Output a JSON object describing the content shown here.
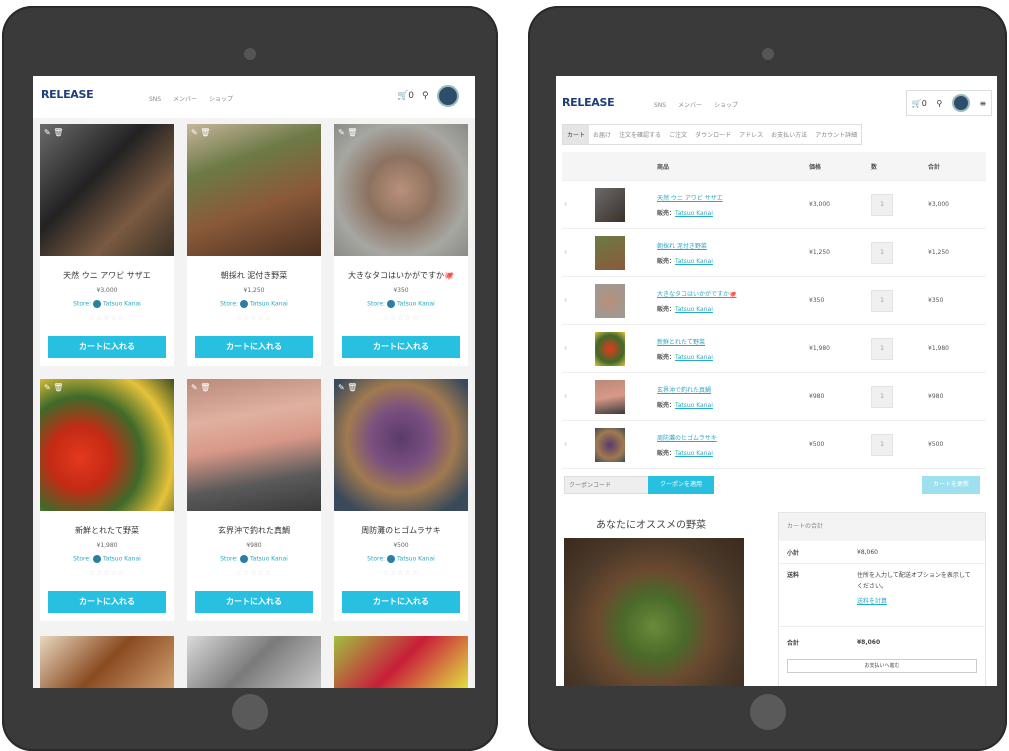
{
  "left": {
    "logo": "RELEASE",
    "nav": [
      "SNS",
      "メンバー",
      "ショップ"
    ],
    "cart_count": "0",
    "products": [
      {
        "name": "天然 ウニ アワビ サザエ",
        "price": "¥3,000",
        "store": "Store:",
        "seller": "Tatsuo Kanai",
        "button": "カートに入れる"
      },
      {
        "name": "朝採れ 泥付き野菜",
        "price": "¥1,250",
        "store": "Store:",
        "seller": "Tatsuo Kanai",
        "button": "カートに入れる"
      },
      {
        "name": "大きなタコはいかがですか🐙",
        "price": "¥350",
        "store": "Store:",
        "seller": "Tatsuo Kanai",
        "button": "カートに入れる"
      },
      {
        "name": "新鮮とれたて野菜",
        "price": "¥1,980",
        "store": "Store:",
        "seller": "Tatsuo Kanai",
        "button": "カートに入れる"
      },
      {
        "name": "玄界沖で釣れた真鯛",
        "price": "¥980",
        "store": "Store:",
        "seller": "Tatsuo Kanai",
        "button": "カートに入れる"
      },
      {
        "name": "周防灘のヒゴムラサキ",
        "price": "¥500",
        "store": "Store:",
        "seller": "Tatsuo Kanai",
        "button": "カートに入れる"
      }
    ]
  },
  "right": {
    "logo": "RELEASE",
    "nav": [
      "SNS",
      "メンバー",
      "ショップ"
    ],
    "cart_count": "0",
    "tabs": [
      "カート",
      "お届け",
      "注文を確認する",
      "ご注文",
      "ダウンロード",
      "アドレス",
      "お支払い方法",
      "アカウント詳細"
    ],
    "columns": [
      "商品",
      "価格",
      "数",
      "合計"
    ],
    "seller_label": "販売：",
    "rows": [
      {
        "name": "天然 ウニ アワビ サザエ",
        "seller": "Tatsuo Kanai",
        "price": "¥3,000",
        "qty": "1",
        "total": "¥3,000"
      },
      {
        "name": "朝採れ 泥付き野菜",
        "seller": "Tatsuo Kanai",
        "price": "¥1,250",
        "qty": "1",
        "total": "¥1,250"
      },
      {
        "name": "大きなタコはいかがですか🐙",
        "seller": "Tatsuo Kanai",
        "price": "¥350",
        "qty": "1",
        "total": "¥350"
      },
      {
        "name": "新鮮とれたて野菜",
        "seller": "Tatsuo Kanai",
        "price": "¥1,980",
        "qty": "1",
        "total": "¥1,980"
      },
      {
        "name": "玄界沖で釣れた真鯛",
        "seller": "Tatsuo Kanai",
        "price": "¥980",
        "qty": "1",
        "total": "¥980"
      },
      {
        "name": "周防灘のヒゴムラサキ",
        "seller": "Tatsuo Kanai",
        "price": "¥500",
        "qty": "1",
        "total": "¥500"
      }
    ],
    "coupon_placeholder": "クーポンコード",
    "apply_coupon": "クーポンを適用",
    "update_cart": "カートを更新",
    "recommend_title": "あなたにオススメの野菜",
    "totals": {
      "heading": "カートの合計",
      "subtotal_label": "小計",
      "subtotal": "¥8,060",
      "shipping_label": "送料",
      "shipping_text": "住所を入力して配送オプションを表示してください。",
      "shipping_calc": "送料を計算",
      "total_label": "合計",
      "total": "¥8,060",
      "checkout": "お支払いへ進む"
    }
  }
}
